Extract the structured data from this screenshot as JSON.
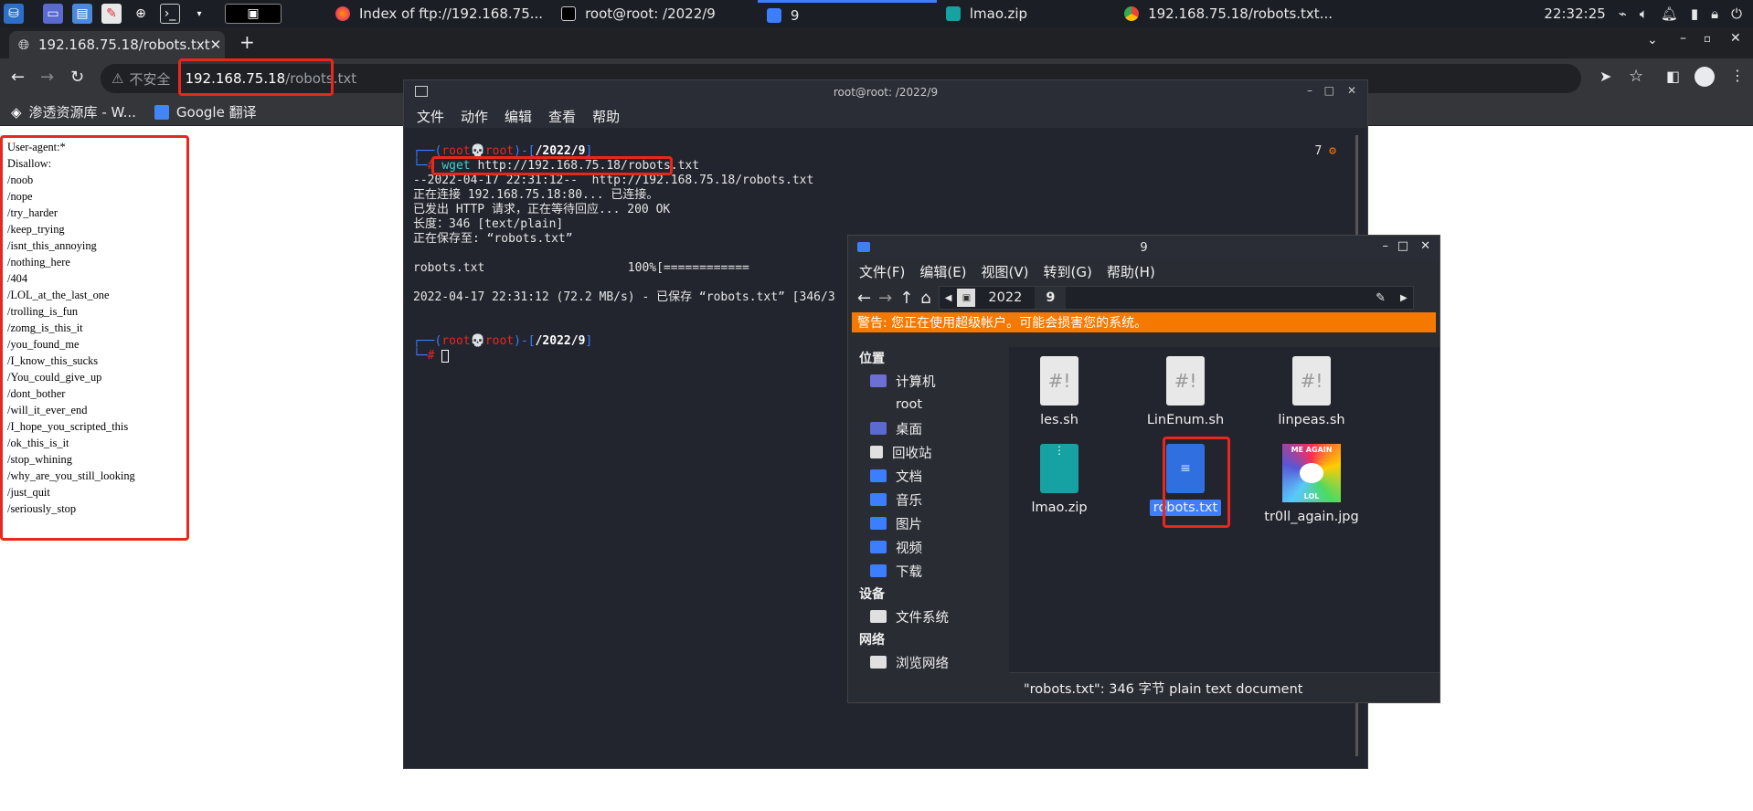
{
  "taskbar": {
    "tasks": [
      {
        "label": "Index of ftp://192.168.75..."
      },
      {
        "label": "root@root: /2022/9"
      },
      {
        "label": "9"
      },
      {
        "label": "lmao.zip"
      },
      {
        "label": "192.168.75.18/robots.txt..."
      }
    ],
    "clock": "22:32:25"
  },
  "browser": {
    "tab_title": "192.168.75.18/robots.txt",
    "insecure_label": "不安全",
    "url_host": "192.168.75.18",
    "url_path": "/robots.txt",
    "bookmarks": [
      {
        "label": "渗透资源库 - W..."
      },
      {
        "label": "Google 翻译"
      }
    ]
  },
  "page": {
    "robots_lines": [
      "User-agent:*",
      "Disallow:",
      "/noob",
      "/nope",
      "/try_harder",
      "/keep_trying",
      "/isnt_this_annoying",
      "/nothing_here",
      "/404",
      "/LOL_at_the_last_one",
      "/trolling_is_fun",
      "/zomg_is_this_it",
      "/you_found_me",
      "/I_know_this_sucks",
      "/You_could_give_up",
      "/dont_bother",
      "/will_it_ever_end",
      "/I_hope_you_scripted_this",
      "/ok_this_is_it",
      "/stop_whining",
      "/why_are_you_still_looking",
      "/just_quit",
      "/seriously_stop"
    ]
  },
  "terminal": {
    "title": "root@root: /2022/9",
    "menu": [
      "文件",
      "动作",
      "编辑",
      "查看",
      "帮助"
    ],
    "prompt_user": "root",
    "prompt_host": "root",
    "prompt_dir": "/2022/9",
    "command_name": "wget",
    "command_arg": "http://192.168.75.18/robots.txt",
    "output_lines": [
      "--2022-04-17 22:31:12--  http://192.168.75.18/robots.txt",
      "正在连接 192.168.75.18:80... 已连接。",
      "已发出 HTTP 请求，正在等待回应... 200 OK",
      "长度：346 [text/plain]",
      "正在保存至: “robots.txt”",
      "",
      "robots.txt                    100%[============",
      "",
      "2022-04-17 22:31:12 (72.2 MB/s) - 已保存 “robots.txt” [346/3"
    ],
    "right_status": "7"
  },
  "filemanager": {
    "title": "9",
    "menu": [
      "文件(F)",
      "编辑(E)",
      "视图(V)",
      "转到(G)",
      "帮助(H)"
    ],
    "path": [
      "2022",
      "9"
    ],
    "warning": "警告: 您正在使用超级帐户。可能会损害您的系统。",
    "sidebar": {
      "places_heading": "位置",
      "places": [
        "计算机",
        "root",
        "桌面",
        "回收站",
        "文档",
        "音乐",
        "图片",
        "视频",
        "下载"
      ],
      "devices_heading": "设备",
      "devices": [
        "文件系统"
      ],
      "network_heading": "网络",
      "network": [
        "浏览网络"
      ]
    },
    "files": [
      {
        "name": "les.sh",
        "type": "script"
      },
      {
        "name": "LinEnum.sh",
        "type": "script"
      },
      {
        "name": "linpeas.sh",
        "type": "script"
      },
      {
        "name": "lmao.zip",
        "type": "zip"
      },
      {
        "name": "robots.txt",
        "type": "text"
      },
      {
        "name": "tr0ll_again.jpg",
        "type": "image"
      }
    ],
    "image_caption_top": "ME AGAIN",
    "image_caption_bottom": "LOL",
    "status": "\"robots.txt\": 346 字节 plain text document"
  },
  "colors": {
    "highlight_red": "#e8271d",
    "accent_blue": "#3d7eff",
    "warning_orange": "#f57900"
  }
}
